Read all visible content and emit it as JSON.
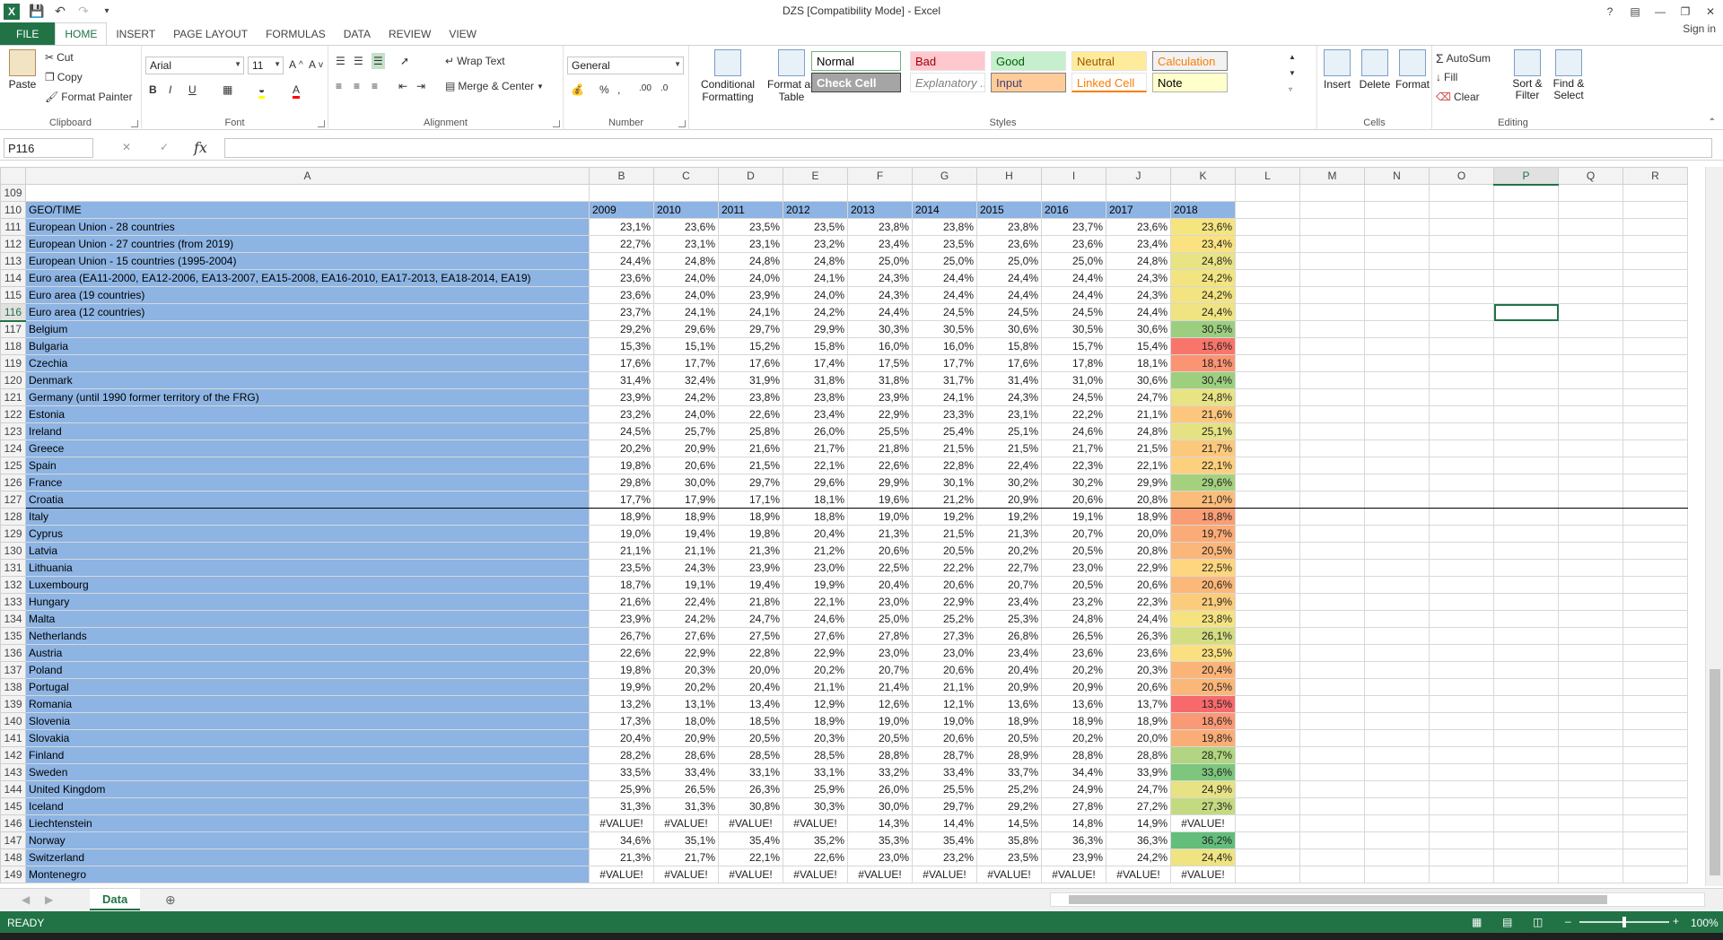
{
  "window": {
    "title": "DZS  [Compatibility Mode] - Excel",
    "signin": "Sign in"
  },
  "tabs": [
    "FILE",
    "HOME",
    "INSERT",
    "PAGE LAYOUT",
    "FORMULAS",
    "DATA",
    "REVIEW",
    "VIEW"
  ],
  "active_tab": "HOME",
  "ribbon": {
    "clipboard": {
      "label": "Clipboard",
      "paste": "Paste",
      "cut": "Cut",
      "copy": "Copy",
      "format_painter": "Format Painter"
    },
    "font": {
      "label": "Font",
      "name": "Arial",
      "size": "11"
    },
    "alignment": {
      "label": "Alignment",
      "wrap_text": "Wrap Text",
      "merge_center": "Merge & Center"
    },
    "number": {
      "label": "Number",
      "format": "General"
    },
    "styles": {
      "label": "Styles",
      "conditional_formatting": "Conditional Formatting",
      "format_as_table": "Format as Table",
      "cells": [
        {
          "name": "Normal",
          "bg": "#ffffff",
          "fg": "#000000",
          "border": "#6cb37e"
        },
        {
          "name": "Bad",
          "bg": "#ffc7ce",
          "fg": "#9c0006"
        },
        {
          "name": "Good",
          "bg": "#c6efce",
          "fg": "#006100"
        },
        {
          "name": "Neutral",
          "bg": "#ffeb9c",
          "fg": "#9c5700"
        },
        {
          "name": "Calculation",
          "bg": "#f2f2f2",
          "fg": "#fa7d00",
          "border": "#7f7f7f"
        },
        {
          "name": "Check Cell",
          "bg": "#a5a5a5",
          "fg": "#ffffff",
          "border": "#3f3f3f"
        },
        {
          "name": "Explanatory ...",
          "bg": "#ffffff",
          "fg": "#7f7f7f"
        },
        {
          "name": "Input",
          "bg": "#ffcc99",
          "fg": "#3f3f76",
          "border": "#7f7f7f"
        },
        {
          "name": "Linked Cell",
          "bg": "#ffffff",
          "fg": "#fa7d00"
        },
        {
          "name": "Note",
          "bg": "#ffffcc",
          "fg": "#000000",
          "border": "#b2b2b2"
        }
      ]
    },
    "cells": {
      "label": "Cells",
      "insert": "Insert",
      "delete": "Delete",
      "format": "Format"
    },
    "editing": {
      "label": "Editing",
      "autosum": "AutoSum",
      "fill": "Fill",
      "clear": "Clear",
      "sort_filter": "Sort & Filter",
      "find_select": "Find & Select"
    }
  },
  "formula_bar": {
    "name_box": "P116",
    "formula": ""
  },
  "columns": [
    "A",
    "B",
    "C",
    "D",
    "E",
    "F",
    "G",
    "H",
    "I",
    "J",
    "K",
    "L",
    "M",
    "N",
    "O",
    "P",
    "Q",
    "R"
  ],
  "selected_cell": {
    "col": "P",
    "row": 116
  },
  "header_row": {
    "row": 110,
    "label": "GEO/TIME",
    "years": [
      "2009",
      "2010",
      "2011",
      "2012",
      "2013",
      "2014",
      "2015",
      "2016",
      "2017",
      "2018"
    ]
  },
  "rows": [
    {
      "row": 111,
      "label": "European Union - 28 countries",
      "values": [
        "23,1%",
        "23,6%",
        "23,5%",
        "23,5%",
        "23,8%",
        "23,8%",
        "23,8%",
        "23,7%",
        "23,6%",
        "23,6%"
      ],
      "k_color": "#f5e57f"
    },
    {
      "row": 112,
      "label": "European Union - 27 countries (from 2019)",
      "values": [
        "22,7%",
        "23,1%",
        "23,1%",
        "23,2%",
        "23,4%",
        "23,5%",
        "23,6%",
        "23,6%",
        "23,4%",
        "23,4%"
      ],
      "k_color": "#f9e27f"
    },
    {
      "row": 113,
      "label": "European Union - 15 countries (1995-2004)",
      "values": [
        "24,4%",
        "24,8%",
        "24,8%",
        "24,8%",
        "25,0%",
        "25,0%",
        "25,0%",
        "25,0%",
        "24,8%",
        "24,8%"
      ],
      "k_color": "#e8e383"
    },
    {
      "row": 114,
      "label": "Euro area (EA11-2000, EA12-2006, EA13-2007, EA15-2008, EA16-2010, EA17-2013, EA18-2014, EA19)",
      "values": [
        "23,6%",
        "24,0%",
        "24,0%",
        "24,1%",
        "24,3%",
        "24,4%",
        "24,4%",
        "24,4%",
        "24,3%",
        "24,2%"
      ],
      "k_color": "#f2e480"
    },
    {
      "row": 115,
      "label": "Euro area (19 countries)",
      "values": [
        "23,6%",
        "24,0%",
        "23,9%",
        "24,0%",
        "24,3%",
        "24,4%",
        "24,4%",
        "24,4%",
        "24,3%",
        "24,2%"
      ],
      "k_color": "#f2e480"
    },
    {
      "row": 116,
      "label": "Euro area (12 countries)",
      "values": [
        "23,7%",
        "24,1%",
        "24,1%",
        "24,2%",
        "24,4%",
        "24,5%",
        "24,5%",
        "24,5%",
        "24,4%",
        "24,4%"
      ],
      "k_color": "#efe481"
    },
    {
      "row": 117,
      "label": "Belgium",
      "values": [
        "29,2%",
        "29,6%",
        "29,7%",
        "29,9%",
        "30,3%",
        "30,5%",
        "30,6%",
        "30,5%",
        "30,6%",
        "30,5%"
      ],
      "k_color": "#9bcf7f"
    },
    {
      "row": 118,
      "label": "Bulgaria",
      "values": [
        "15,3%",
        "15,1%",
        "15,2%",
        "15,8%",
        "16,0%",
        "16,0%",
        "15,8%",
        "15,7%",
        "15,4%",
        "15,6%"
      ],
      "k_color": "#f8756b"
    },
    {
      "row": 119,
      "label": "Czechia",
      "values": [
        "17,6%",
        "17,7%",
        "17,6%",
        "17,4%",
        "17,5%",
        "17,7%",
        "17,6%",
        "17,8%",
        "18,1%",
        "18,1%"
      ],
      "k_color": "#fa9473"
    },
    {
      "row": 120,
      "label": "Denmark",
      "values": [
        "31,4%",
        "32,4%",
        "31,9%",
        "31,8%",
        "31,8%",
        "31,7%",
        "31,4%",
        "31,0%",
        "30,6%",
        "30,4%"
      ],
      "k_color": "#9dcf7f"
    },
    {
      "row": 121,
      "label": "Germany (until 1990 former territory of the FRG)",
      "values": [
        "23,9%",
        "24,2%",
        "23,8%",
        "23,8%",
        "23,9%",
        "24,1%",
        "24,3%",
        "24,5%",
        "24,7%",
        "24,8%"
      ],
      "k_color": "#e8e383"
    },
    {
      "row": 122,
      "label": "Estonia",
      "values": [
        "23,2%",
        "24,0%",
        "22,6%",
        "23,4%",
        "22,9%",
        "23,3%",
        "23,1%",
        "22,2%",
        "21,1%",
        "21,6%"
      ],
      "k_color": "#fcc77c"
    },
    {
      "row": 123,
      "label": "Ireland",
      "values": [
        "24,5%",
        "25,7%",
        "25,8%",
        "26,0%",
        "25,5%",
        "25,4%",
        "25,1%",
        "24,6%",
        "24,8%",
        "25,1%"
      ],
      "k_color": "#e4e283"
    },
    {
      "row": 124,
      "label": "Greece",
      "values": [
        "20,2%",
        "20,9%",
        "21,6%",
        "21,7%",
        "21,8%",
        "21,5%",
        "21,5%",
        "21,7%",
        "21,5%",
        "21,7%"
      ],
      "k_color": "#fcc87c"
    },
    {
      "row": 125,
      "label": "Spain",
      "values": [
        "19,8%",
        "20,6%",
        "21,5%",
        "22,1%",
        "22,6%",
        "22,8%",
        "22,4%",
        "22,3%",
        "22,1%",
        "22,1%"
      ],
      "k_color": "#fdd07e"
    },
    {
      "row": 126,
      "label": "France",
      "values": [
        "29,8%",
        "30,0%",
        "29,7%",
        "29,6%",
        "29,9%",
        "30,1%",
        "30,2%",
        "30,2%",
        "29,9%",
        "29,6%"
      ],
      "k_color": "#a5d17f"
    },
    {
      "row": 127,
      "label": "Croatia",
      "values": [
        "17,7%",
        "17,9%",
        "17,1%",
        "18,1%",
        "19,6%",
        "21,2%",
        "20,9%",
        "20,6%",
        "20,8%",
        "21,0%"
      ],
      "k_color": "#fcbd7b",
      "boxed": true
    },
    {
      "row": 128,
      "label": "Italy",
      "values": [
        "18,9%",
        "18,9%",
        "18,9%",
        "18,8%",
        "19,0%",
        "19,2%",
        "19,2%",
        "19,1%",
        "18,9%",
        "18,8%"
      ],
      "k_color": "#fa9d75"
    },
    {
      "row": 129,
      "label": "Cyprus",
      "values": [
        "19,0%",
        "19,4%",
        "19,8%",
        "20,4%",
        "21,3%",
        "21,5%",
        "21,3%",
        "20,7%",
        "20,0%",
        "19,7%"
      ],
      "k_color": "#fbab77"
    },
    {
      "row": 130,
      "label": "Latvia",
      "values": [
        "21,1%",
        "21,1%",
        "21,3%",
        "21,2%",
        "20,6%",
        "20,5%",
        "20,2%",
        "20,5%",
        "20,8%",
        "20,5%"
      ],
      "k_color": "#fbb679"
    },
    {
      "row": 131,
      "label": "Lithuania",
      "values": [
        "23,5%",
        "24,3%",
        "23,9%",
        "23,0%",
        "22,5%",
        "22,2%",
        "22,7%",
        "23,0%",
        "22,9%",
        "22,5%"
      ],
      "k_color": "#fdd67f"
    },
    {
      "row": 132,
      "label": "Luxembourg",
      "values": [
        "18,7%",
        "19,1%",
        "19,4%",
        "19,9%",
        "20,4%",
        "20,6%",
        "20,7%",
        "20,5%",
        "20,6%",
        "20,6%"
      ],
      "k_color": "#fbb879"
    },
    {
      "row": 133,
      "label": "Hungary",
      "values": [
        "21,6%",
        "22,4%",
        "21,8%",
        "22,1%",
        "23,0%",
        "22,9%",
        "23,4%",
        "23,2%",
        "22,3%",
        "21,9%"
      ],
      "k_color": "#fccc7d"
    },
    {
      "row": 134,
      "label": "Malta",
      "values": [
        "23,9%",
        "24,2%",
        "24,7%",
        "24,6%",
        "25,0%",
        "25,2%",
        "25,3%",
        "24,8%",
        "24,4%",
        "23,8%"
      ],
      "k_color": "#f6e380"
    },
    {
      "row": 135,
      "label": "Netherlands",
      "values": [
        "26,7%",
        "27,6%",
        "27,5%",
        "27,6%",
        "27,8%",
        "27,3%",
        "26,8%",
        "26,5%",
        "26,3%",
        "26,1%"
      ],
      "k_color": "#d3dd82"
    },
    {
      "row": 136,
      "label": "Austria",
      "values": [
        "22,6%",
        "22,9%",
        "22,8%",
        "22,9%",
        "23,0%",
        "23,0%",
        "23,4%",
        "23,6%",
        "23,6%",
        "23,5%"
      ],
      "k_color": "#fbe07f"
    },
    {
      "row": 137,
      "label": "Poland",
      "values": [
        "19,8%",
        "20,3%",
        "20,0%",
        "20,2%",
        "20,7%",
        "20,6%",
        "20,4%",
        "20,2%",
        "20,3%",
        "20,4%"
      ],
      "k_color": "#fbb478"
    },
    {
      "row": 138,
      "label": "Portugal",
      "values": [
        "19,9%",
        "20,2%",
        "20,4%",
        "21,1%",
        "21,4%",
        "21,1%",
        "20,9%",
        "20,9%",
        "20,6%",
        "20,5%"
      ],
      "k_color": "#fbb679"
    },
    {
      "row": 139,
      "label": "Romania",
      "values": [
        "13,2%",
        "13,1%",
        "13,4%",
        "12,9%",
        "12,6%",
        "12,1%",
        "13,6%",
        "13,6%",
        "13,7%",
        "13,5%"
      ],
      "k_color": "#f8696b"
    },
    {
      "row": 140,
      "label": "Slovenia",
      "values": [
        "17,3%",
        "18,0%",
        "18,5%",
        "18,9%",
        "19,0%",
        "19,0%",
        "18,9%",
        "18,9%",
        "18,9%",
        "18,6%"
      ],
      "k_color": "#fa9975"
    },
    {
      "row": 141,
      "label": "Slovakia",
      "values": [
        "20,4%",
        "20,9%",
        "20,5%",
        "20,3%",
        "20,5%",
        "20,6%",
        "20,5%",
        "20,2%",
        "20,0%",
        "19,8%"
      ],
      "k_color": "#fbad77"
    },
    {
      "row": 142,
      "label": "Finland",
      "values": [
        "28,2%",
        "28,6%",
        "28,5%",
        "28,5%",
        "28,8%",
        "28,7%",
        "28,9%",
        "28,8%",
        "28,8%",
        "28,7%"
      ],
      "k_color": "#b1d580"
    },
    {
      "row": 143,
      "label": "Sweden",
      "values": [
        "33,5%",
        "33,4%",
        "33,1%",
        "33,1%",
        "33,2%",
        "33,4%",
        "33,7%",
        "34,4%",
        "33,9%",
        "33,6%"
      ],
      "k_color": "#7cc67d"
    },
    {
      "row": 144,
      "label": "United Kingdom",
      "values": [
        "25,9%",
        "26,5%",
        "26,3%",
        "25,9%",
        "26,0%",
        "25,5%",
        "25,2%",
        "24,9%",
        "24,7%",
        "24,9%"
      ],
      "k_color": "#e7e283"
    },
    {
      "row": 145,
      "label": "Iceland",
      "values": [
        "31,3%",
        "31,3%",
        "30,8%",
        "30,3%",
        "30,0%",
        "29,7%",
        "29,2%",
        "27,8%",
        "27,2%",
        "27,3%"
      ],
      "k_color": "#c4da81"
    },
    {
      "row": 146,
      "label": "Liechtenstein",
      "values": [
        "#VALUE!",
        "#VALUE!",
        "#VALUE!",
        "#VALUE!",
        "14,3%",
        "14,4%",
        "14,5%",
        "14,8%",
        "14,9%",
        "#VALUE!"
      ],
      "k_color": "#ffffff"
    },
    {
      "row": 147,
      "label": "Norway",
      "values": [
        "34,6%",
        "35,1%",
        "35,4%",
        "35,2%",
        "35,3%",
        "35,4%",
        "35,8%",
        "36,3%",
        "36,3%",
        "36,2%"
      ],
      "k_color": "#63be7b"
    },
    {
      "row": 148,
      "label": "Switzerland",
      "values": [
        "21,3%",
        "21,7%",
        "22,1%",
        "22,6%",
        "23,0%",
        "23,2%",
        "23,5%",
        "23,9%",
        "24,2%",
        "24,4%"
      ],
      "k_color": "#efe481"
    },
    {
      "row": 149,
      "label": "Montenegro",
      "values": [
        "#VALUE!",
        "#VALUE!",
        "#VALUE!",
        "#VALUE!",
        "#VALUE!",
        "#VALUE!",
        "#VALUE!",
        "#VALUE!",
        "#VALUE!",
        "#VALUE!"
      ],
      "k_color": "#ffffff"
    }
  ],
  "sheet_tabs": [
    "Data"
  ],
  "status": {
    "ready": "READY",
    "zoom": "100%"
  }
}
